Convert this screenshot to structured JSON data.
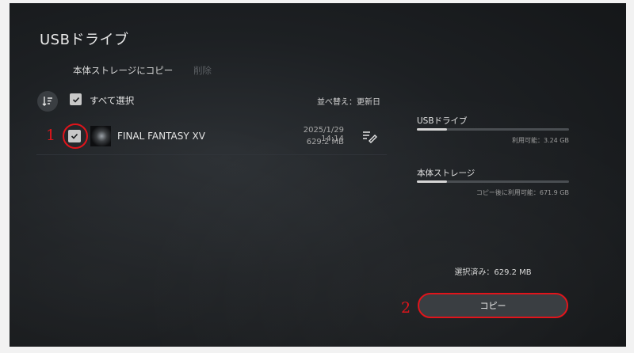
{
  "header": {
    "title": "USBドライブ",
    "action_copy": "本体ストレージにコピー",
    "action_delete": "削除"
  },
  "toolbar": {
    "select_all_label": "すべて選択",
    "sort_label": "並べ替え：更新日",
    "select_all_checked": true
  },
  "items": [
    {
      "title": "FINAL FANTASY XV",
      "date": "2025/1/29  14:14",
      "size": "629.2 MB",
      "checked": true
    }
  ],
  "storage": {
    "usb": {
      "label": "USBドライブ",
      "available": "利用可能：3.24 GB",
      "used_fraction": 0.2
    },
    "internal": {
      "label": "本体ストレージ",
      "available_after_copy": "コピー後に利用可能：671.9 GB",
      "used_fraction": 0.2
    }
  },
  "selection": {
    "total": "選択済み：629.2 MB"
  },
  "copy_button": {
    "label": "コピー"
  },
  "annotations": {
    "marker_1": "1",
    "marker_2": "2",
    "color": "#e1141b"
  }
}
